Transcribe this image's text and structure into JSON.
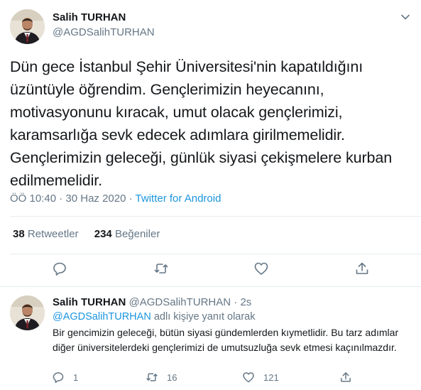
{
  "main_tweet": {
    "author_name": "Salih TURHAN",
    "author_handle": "@AGDSalihTURHAN",
    "text": "Dün gece İstanbul Şehir Üniversitesi'nin kapatıldığını üzüntüyle öğrendim. Gençlerimizin heyecanını, motivasyonunu kıracak, umut olacak gençlerimizi, karamsarlığa sevk edecek adımlara girilmemelidir. Gençlerimizin geleceği, günlük siyasi çekişmelere kurban edilmemelidir.",
    "time": "ÖÖ 10:40",
    "separator": " · ",
    "date": "30 Haz 2020",
    "source": "Twitter for Android",
    "retweet_count": "38",
    "retweet_label": "Retweetler",
    "like_count": "234",
    "like_label": "Beğeniler",
    "icons": [
      "caret-down-icon",
      "reply-icon",
      "retweet-icon",
      "like-icon",
      "share-icon"
    ]
  },
  "reply_tweet": {
    "author_name": "Salih TURHAN",
    "author_handle": "@AGDSalihTURHAN",
    "age": "2s",
    "replying_to_handle": "@AGDSalihTURHAN",
    "replying_to_suffix": "adlı kişiye yanıt olarak",
    "text": "Bir gencimizin geleceği, bütün siyasi gündemlerden kıymetlidir. Bu tarz adımlar diğer üniversitelerdeki gençlerimizi de umutsuzluğa sevk etmesi kaçınılmazdır.",
    "reply_count": "1",
    "retweet_count": "16",
    "like_count": "121"
  },
  "colors": {
    "link": "#1b95e0",
    "secondary_text": "#657786",
    "primary_text": "#14171a",
    "divider": "#e6ecf0"
  }
}
